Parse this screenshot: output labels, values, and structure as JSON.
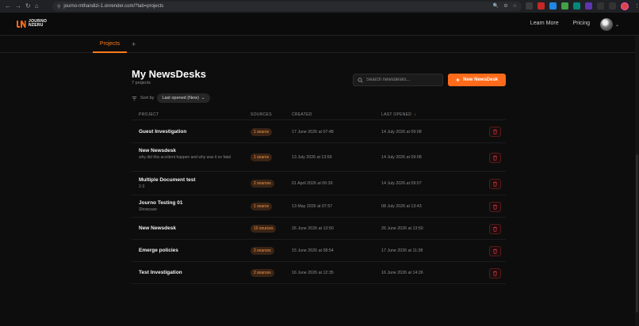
{
  "browser": {
    "url": "journo-mthandizi-1.onrender.com/?tab=projects",
    "nav": {
      "back": "←",
      "forward": "→",
      "reload": "↻",
      "home": "⌂"
    },
    "omni_icons": [
      "🔍",
      "⚙",
      "☆"
    ]
  },
  "header": {
    "logo_line1": "JOURNO",
    "logo_line2": "NZERU",
    "nav": {
      "learn_more": "Learn More",
      "pricing": "Pricing"
    },
    "avatar_chevron": "⌄"
  },
  "tabs": [
    {
      "label": "Projects"
    }
  ],
  "add_tab": "+",
  "main": {
    "title": "My NewsDesks",
    "count": "7 projects",
    "search_placeholder": "Search newsdesks...",
    "new_button": "New NewsDesk",
    "new_button_icon": "+",
    "sort_label": "Sort by",
    "sort_value": "Last opened (New)",
    "sort_chevron": "⌄"
  },
  "table": {
    "headers": {
      "project": "PROJECT",
      "sources": "SOURCES",
      "created": "CREATED",
      "last_opened": "LAST OPENED",
      "sort_arrow": "↓"
    },
    "rows": [
      {
        "name": "Guest Investigation",
        "desc": "",
        "sources": "1 source",
        "created": "17 June 2026 at 07:48",
        "opened": "14 July 2026 at 09:08"
      },
      {
        "name": "New Newsdesk",
        "desc": "why did this accident happen and why was it so fatal",
        "sources": "1 source",
        "created": "13 July 2026 at 13:56",
        "opened": "14 July 2026 at 09:08"
      },
      {
        "name": "Multiple Document test",
        "desc": "2-3",
        "sources": "2 sources",
        "created": "01 April 2026 at 06:39",
        "opened": "14 July 2026 at 09:07"
      },
      {
        "name": "Journo Testing 01",
        "desc": "Showcase",
        "sources": "1 source",
        "created": "13 May 2026 at 07:57",
        "opened": "08 July 2026 at 13:43"
      },
      {
        "name": "New Newsdesk",
        "desc": "",
        "sources": "10 sources",
        "created": "26 June 2026 at 13:50",
        "opened": "26 June 2026 at 13:50"
      },
      {
        "name": "Emerge policies",
        "desc": "",
        "sources": "2 sources",
        "created": "15 June 2026 at 08:54",
        "opened": "17 June 2026 at 11:38"
      },
      {
        "name": "Test Investigation",
        "desc": "",
        "sources": "2 sources",
        "created": "16 June 2026 at 12:35",
        "opened": "16 June 2026 at 14:26"
      }
    ]
  },
  "colors": {
    "accent": "#ff6b1a",
    "background": "#0d0d0d",
    "danger": "#e0313b"
  }
}
